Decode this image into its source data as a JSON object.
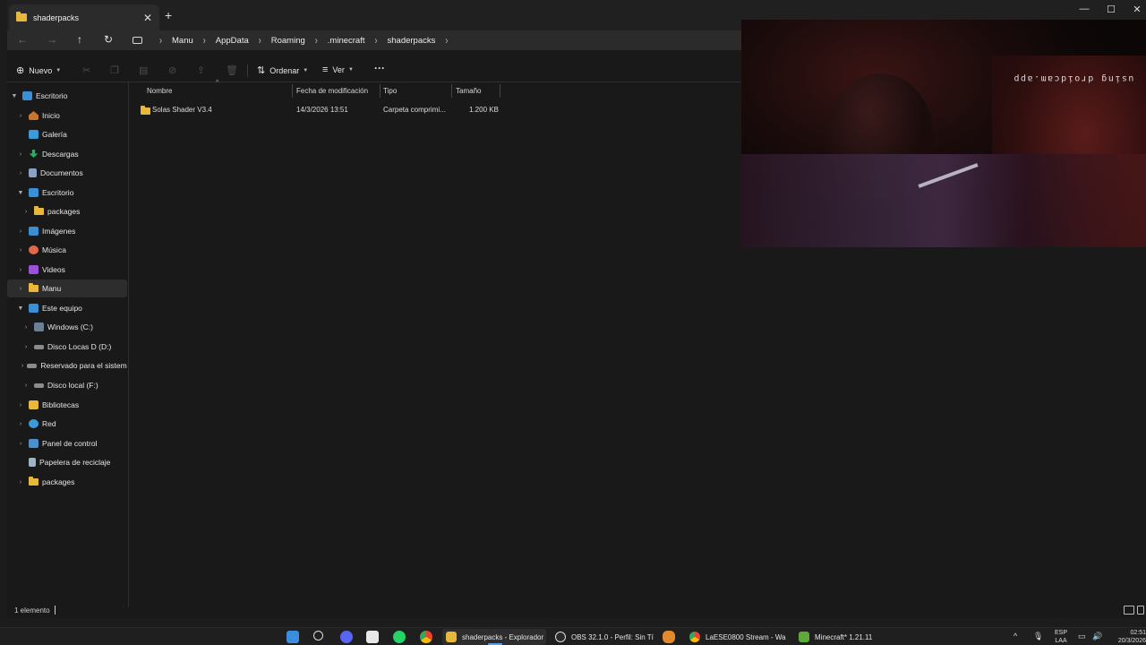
{
  "window": {
    "tab_title": "shaderpacks",
    "new_tab": "+",
    "tab_close": "✕",
    "controls": {
      "minimize": "—",
      "maximize": "☐",
      "close": "✕"
    }
  },
  "nav": {
    "back": "←",
    "forward": "→",
    "up": "↑",
    "refresh": "↻",
    "breadcrumbs": [
      "Manu",
      "AppData",
      "Roaming",
      ".minecraft",
      "shaderpacks"
    ],
    "separator": "›"
  },
  "toolbar": {
    "new_label": "Nuevo",
    "sort_label": "Ordenar",
    "view_label": "Ver",
    "more_label": "···",
    "icons": [
      "cut-icon",
      "copy-icon",
      "paste-icon",
      "rename-icon",
      "share-icon",
      "delete-icon"
    ]
  },
  "sidebar": {
    "items": [
      {
        "label": "Escritorio",
        "icon": "desktop-icon",
        "expanded": true
      },
      {
        "label": "Inicio",
        "icon": "home-icon"
      },
      {
        "label": "Galería",
        "icon": "gallery-icon"
      },
      {
        "label": "Descargas",
        "icon": "downloads-icon"
      },
      {
        "label": "Documentos",
        "icon": "documents-icon"
      },
      {
        "label": "Escritorio",
        "icon": "desktop-icon",
        "expanded": true
      },
      {
        "label": "packages",
        "icon": "folder-icon"
      },
      {
        "label": "Imágenes",
        "icon": "pictures-icon"
      },
      {
        "label": "Música",
        "icon": "music-icon"
      },
      {
        "label": "Videos",
        "icon": "videos-icon"
      },
      {
        "label": "Manu",
        "icon": "folder-icon",
        "selected": true
      },
      {
        "label": "Este equipo",
        "icon": "computer-icon",
        "expanded": true
      },
      {
        "label": "Windows (C:)",
        "icon": "windows-drive-icon"
      },
      {
        "label": "Disco Locas D (D:)",
        "icon": "drive-icon"
      },
      {
        "label": "Reservado para el sistema",
        "icon": "drive-icon"
      },
      {
        "label": "Disco local (F:)",
        "icon": "drive-icon"
      },
      {
        "label": "Bibliotecas",
        "icon": "libraries-icon"
      },
      {
        "label": "Red",
        "icon": "network-icon"
      },
      {
        "label": "Panel de control",
        "icon": "control-panel-icon"
      },
      {
        "label": "Papelera de reciclaje",
        "icon": "recycle-bin-icon"
      },
      {
        "label": "packages",
        "icon": "folder-icon"
      }
    ]
  },
  "files": {
    "columns": [
      "Nombre",
      "Fecha de modificación",
      "Tipo",
      "Tamaño"
    ],
    "rows": [
      {
        "name": "Solas Shader V3.4",
        "modified": "14/3/2026 13:51",
        "type": "Carpeta comprimi...",
        "size": "1.200 KB"
      }
    ]
  },
  "status": {
    "count": "1 elemento"
  },
  "webcam": {
    "watermark": "using droidcam.app"
  },
  "taskbar": {
    "apps": [
      {
        "label": "shaderpacks - Explorador",
        "color": "#e8b83a",
        "active": true
      },
      {
        "label": "OBS 32.1.0 - Perfil: Sin Tí",
        "color": "#3a3a3a"
      },
      {
        "label": "LaESE0800 Stream - Wa",
        "color": "#3b82d6"
      },
      {
        "label": "Minecraft* 1.21.11",
        "color": "#5fa83a"
      }
    ],
    "tray": {
      "lang_top": "ESP",
      "lang_bottom": "LAA",
      "time": "02:51",
      "date": "20/3/2026"
    }
  },
  "colors": {
    "accent": "#5aa0e8",
    "folder": "#e8b83a",
    "background": "#191919"
  }
}
